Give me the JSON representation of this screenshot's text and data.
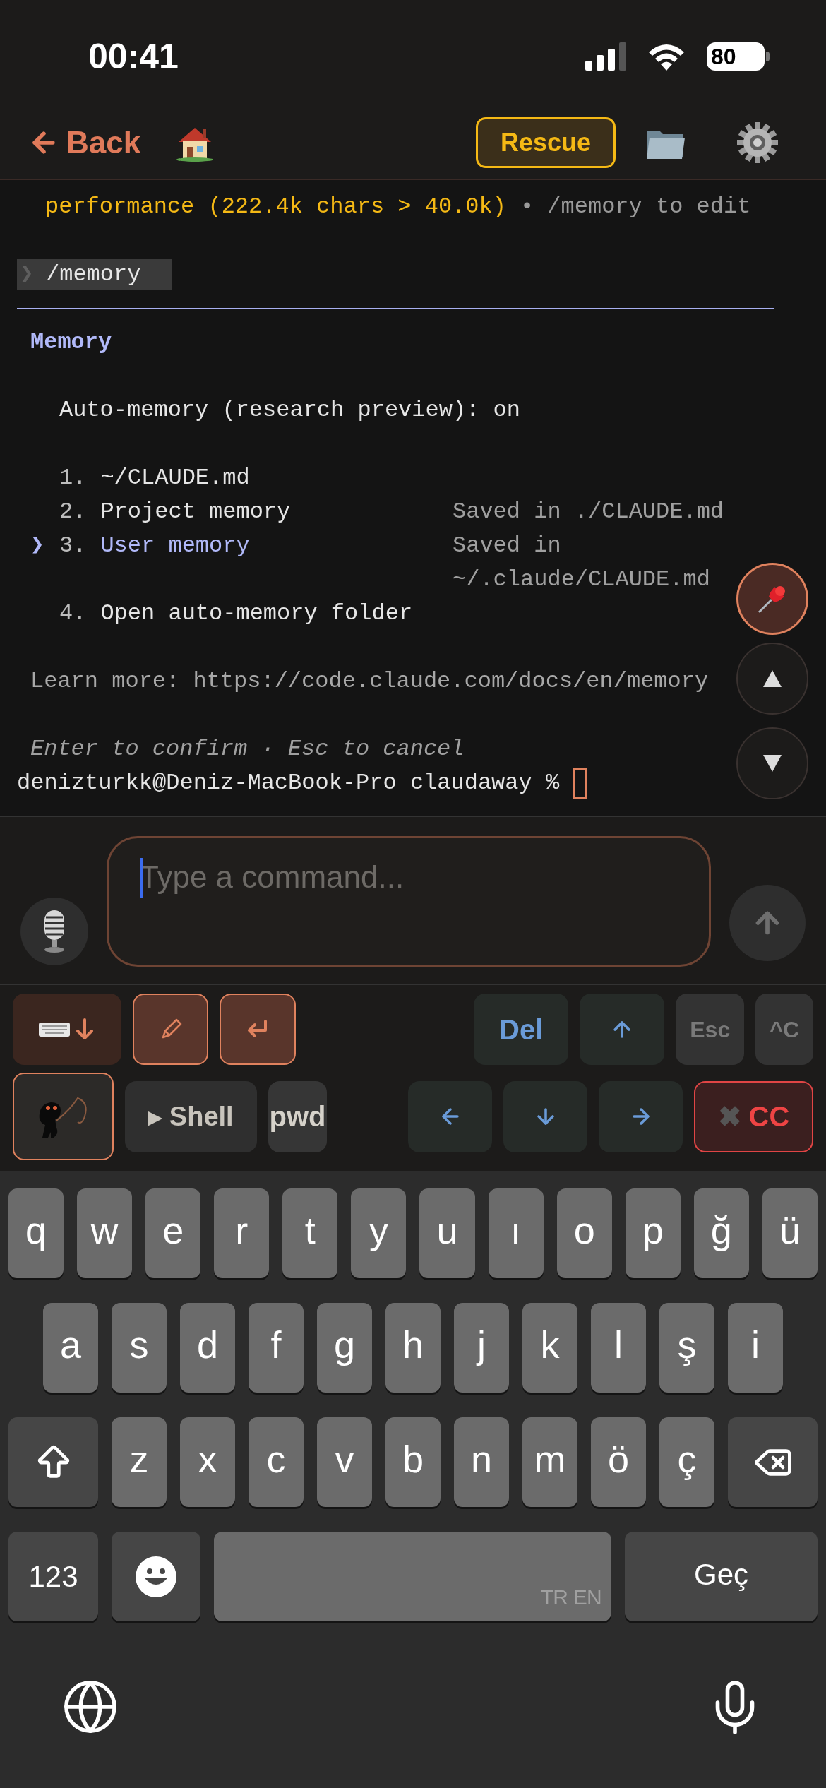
{
  "status_bar": {
    "time": "00:41",
    "battery": "80"
  },
  "nav": {
    "back": "Back",
    "rescue": "Rescue"
  },
  "terminal": {
    "notice": {
      "text": "performance (222.4k chars > 40.0k)",
      "hint": "• /memory to edit"
    },
    "command": {
      "prompt": "❯",
      "text": "/memory"
    },
    "panel": {
      "title": "Memory",
      "status": "Auto-memory (research preview): on",
      "pointer": "❯",
      "options": [
        {
          "number": "1.",
          "label": "~/CLAUDE.md",
          "selected": false
        },
        {
          "number": "2.",
          "label": "Project memory",
          "note": "Saved in ./CLAUDE.md",
          "selected": false
        },
        {
          "number": "3.",
          "label": "User memory",
          "note": "Saved in ~/.claude/CLAUDE.md",
          "selected": true
        },
        {
          "number": "4.",
          "label": "Open auto-memory folder",
          "selected": false
        }
      ],
      "learn_more": "Learn more: https://code.claude.com/docs/en/memory",
      "footer": "Enter to confirm · Esc to cancel"
    },
    "shell_prompt": "denizturkk@Deniz-MacBook-Pro claudaway %"
  },
  "input": {
    "placeholder": "Type a command..."
  },
  "toolbar": {
    "rows": [
      {
        "left": [
          {
            "kind": "hide_keyboard"
          },
          {
            "kind": "pencil"
          },
          {
            "kind": "return"
          }
        ],
        "right": [
          {
            "kind": "delete",
            "label": "Del"
          },
          {
            "kind": "arrow_up"
          },
          {
            "kind": "escape",
            "label": "Esc"
          },
          {
            "kind": "control",
            "label": "^C"
          }
        ]
      },
      {
        "left": [
          {
            "kind": "dino"
          },
          {
            "kind": "shell",
            "label": "▸ Shell"
          },
          {
            "kind": "command",
            "label": "pwd"
          }
        ],
        "right": [
          {
            "kind": "arrow_left"
          },
          {
            "kind": "arrow_down"
          },
          {
            "kind": "arrow_right"
          },
          {
            "kind": "cancel",
            "mark": "✖",
            "label": "CC"
          }
        ]
      }
    ]
  },
  "keyboard": {
    "letter_rows": [
      [
        "q",
        "w",
        "e",
        "r",
        "t",
        "y",
        "u",
        "ı",
        "o",
        "p",
        "ğ",
        "ü"
      ],
      [
        "a",
        "s",
        "d",
        "f",
        "g",
        "h",
        "j",
        "k",
        "l",
        "ş",
        "i"
      ],
      [
        "z",
        "x",
        "c",
        "v",
        "b",
        "n",
        "m",
        "ö",
        "ç"
      ]
    ],
    "numbers_key": "123",
    "space_hint": "TR EN",
    "return_key": "Geç"
  }
}
